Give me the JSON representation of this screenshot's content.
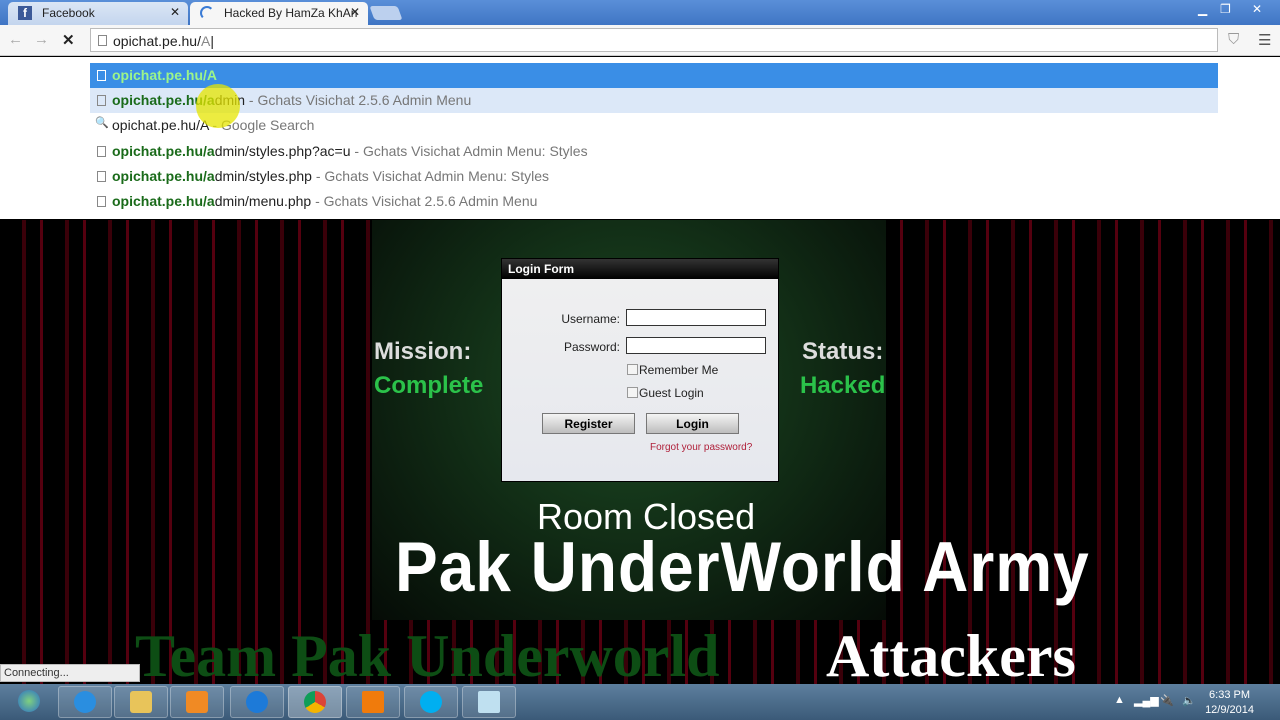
{
  "browser": {
    "tabs": [
      {
        "label": "Facebook",
        "icon": "facebook-icon"
      },
      {
        "label": "Hacked By HamZa KhAn",
        "icon": "loading-spinner-icon"
      }
    ],
    "address": {
      "typed": "opichat.pe.hu/",
      "autocomplete": "A"
    },
    "suggestions": [
      {
        "bold": "opichat.pe.hu/A",
        "rest": "",
        "desc": "",
        "icon": "page-icon"
      },
      {
        "bold": "opichat.pe.hu/a",
        "rest": "dmin",
        "desc": " - Gchats Visichat 2.5.6 Admin Menu",
        "icon": "page-icon"
      },
      {
        "bold": "",
        "rest": "opichat.pe.hu/A",
        "desc": " - Google Search",
        "icon": "search-icon"
      },
      {
        "bold": "opichat.pe.hu/a",
        "rest": "dmin/styles.php?ac=u",
        "desc": " - Gchats Visichat Admin Menu: Styles",
        "icon": "page-icon"
      },
      {
        "bold": "opichat.pe.hu/a",
        "rest": "dmin/styles.php",
        "desc": " - Gchats Visichat Admin Menu: Styles",
        "icon": "page-icon"
      },
      {
        "bold": "opichat.pe.hu/a",
        "rest": "dmin/menu.php",
        "desc": " - Gchats Visichat 2.5.6 Admin Menu",
        "icon": "page-icon"
      }
    ],
    "status": "Connecting..."
  },
  "page": {
    "mission": "Mission:",
    "complete": "Complete",
    "status": "Status:",
    "hacked": "Hacked",
    "room": "Room Closed",
    "army": "Pak UnderWorld Army",
    "team": "Team Pak Underworld",
    "attackers": "Attackers",
    "login": {
      "title": "Login Form",
      "username_label": "Username:",
      "password_label": "Password:",
      "remember": "Remember Me",
      "guest": "Guest Login",
      "register": "Register",
      "login": "Login",
      "forgot": "Forgot your password?"
    }
  },
  "taskbar": {
    "time": "6:33 PM",
    "date": "12/9/2014"
  }
}
